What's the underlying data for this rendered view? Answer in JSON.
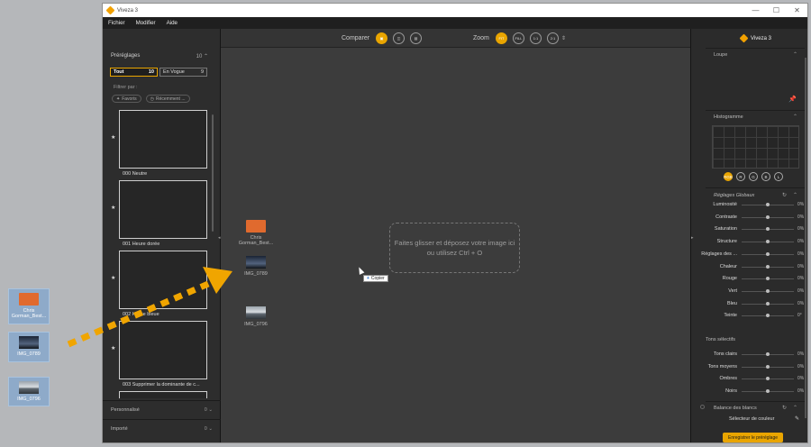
{
  "desktop": {
    "icons": [
      {
        "label": "Chris Gorman_Best...",
        "icon": "book-icon"
      },
      {
        "label": "IMG_0789",
        "icon": "image-icon"
      },
      {
        "label": "IMG_0796",
        "icon": "image-icon"
      }
    ],
    "arrow_color": "#f0a500"
  },
  "window": {
    "title": "Viveza 3",
    "controls": [
      "—",
      "☐",
      "✕"
    ]
  },
  "menu": [
    "Fichier",
    "Modifier",
    "Aide"
  ],
  "left_panel": {
    "title": "Préréglages",
    "count": "10",
    "tabs": [
      {
        "label": "Tout",
        "count": "10"
      },
      {
        "label": "En Vogue",
        "count": "9"
      }
    ],
    "filter_label": "Filtrer par :",
    "chips": [
      "Favoris",
      "Récemment ..."
    ],
    "presets": [
      "000 Neutre",
      "001 Heure dorée",
      "002 Heure bleue",
      "003 Supprimer la dominante de c..."
    ],
    "star": "★",
    "sections": [
      {
        "label": "Personnalisé",
        "count": "0"
      },
      {
        "label": "Importé",
        "count": "0"
      }
    ]
  },
  "toolbar": {
    "compare_label": "Comparer",
    "zoom_label": "Zoom",
    "zoom_buttons": [
      "FIT",
      "FILL",
      "1:1",
      "2:1"
    ]
  },
  "center": {
    "dropzone_text": "Faites glisser et déposez votre image ici ou utilisez Ctrl + O",
    "files": [
      {
        "label": "Chris Gorman_Best..."
      },
      {
        "label": "IMG_0789"
      },
      {
        "label": "IMG_0796"
      }
    ],
    "copy_tip": "Copier"
  },
  "right_panel": {
    "app_name": "Viveza 3",
    "loupe": "Loupe",
    "histogram": "Histogramme",
    "hist_buttons": [
      "RGB",
      "R",
      "G",
      "B",
      "L"
    ],
    "global_title": "Réglages Globaux",
    "global_sliders": [
      {
        "label": "Luminosité",
        "value": "0%",
        "level": 0.5
      },
      {
        "label": "Contraste",
        "value": "0%",
        "level": 0.5
      },
      {
        "label": "Saturation",
        "value": "0%",
        "level": 0.5
      },
      {
        "label": "Structure",
        "value": "0%",
        "level": 0.5
      },
      {
        "label": "Réglages des ...",
        "value": "0%",
        "level": 0.5
      },
      {
        "label": "Chaleur",
        "value": "0%",
        "level": 0.5
      },
      {
        "label": "Rouge",
        "value": "0%",
        "level": 0.5
      },
      {
        "label": "Vert",
        "value": "0%",
        "level": 0.5
      },
      {
        "label": "Bleu",
        "value": "0%",
        "level": 0.5
      },
      {
        "label": "Teinte",
        "value": "0°",
        "level": 0.5
      }
    ],
    "tones_title": "Tons sélectifs",
    "tone_sliders": [
      {
        "label": "Tons clairs",
        "value": "0%",
        "level": 0.5
      },
      {
        "label": "Tons moyens",
        "value": "0%",
        "level": 0.5
      },
      {
        "label": "Ombres",
        "value": "0%",
        "level": 0.5
      },
      {
        "label": "Noirs",
        "value": "0%",
        "level": 0.5
      }
    ],
    "white_balance": "Balance des blancs",
    "color_picker": "Sélecteur de couleur",
    "save_button": "Enregistrer le préréglage"
  }
}
